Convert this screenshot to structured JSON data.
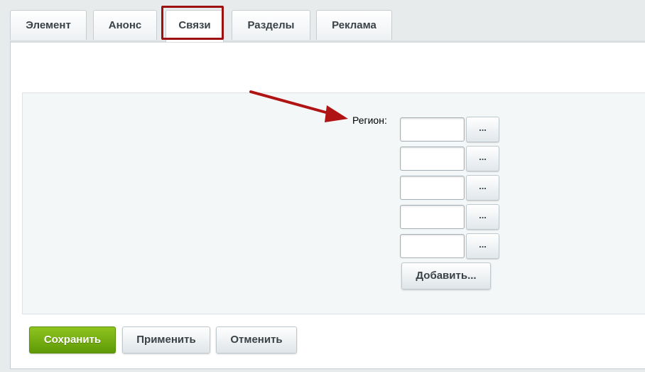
{
  "tabs": [
    {
      "label": "Элемент",
      "active": false
    },
    {
      "label": "Анонс",
      "active": false
    },
    {
      "label": "Связи",
      "active": true
    },
    {
      "label": "Разделы",
      "active": false
    },
    {
      "label": "Реклама",
      "active": false
    }
  ],
  "form": {
    "region_label": "Регион:",
    "region_inputs": [
      "",
      "",
      "",
      "",
      ""
    ],
    "picker_label": "...",
    "add_label": "Добавить..."
  },
  "actions": {
    "save_label": "Сохранить",
    "apply_label": "Применить",
    "cancel_label": "Отменить"
  },
  "colors": {
    "highlight": "#9e1111",
    "primary_button": "#76b012"
  }
}
